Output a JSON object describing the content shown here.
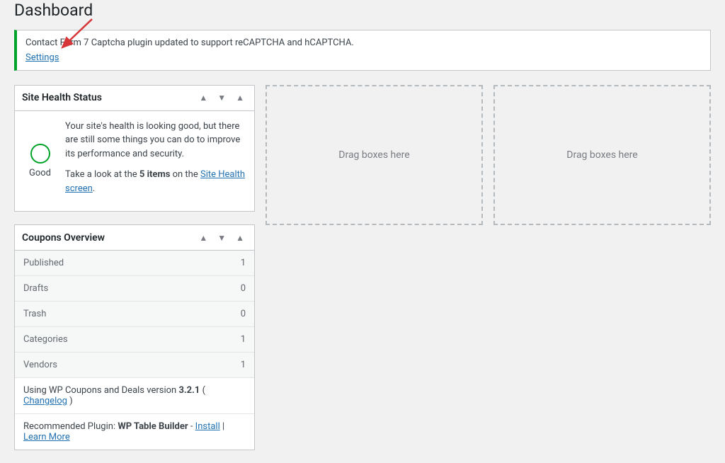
{
  "page_title": "Dashboard",
  "notice": {
    "text": "Contact Form 7 Captcha plugin updated to support reCAPTCHA and hCAPTCHA.",
    "link_label": "Settings"
  },
  "site_health": {
    "title": "Site Health Status",
    "status_label": "Good",
    "description_1": "Your site's health is looking good, but there are still some things you can do to improve its performance and security.",
    "description_2_prefix": "Take a look at the ",
    "items_count": "5 items",
    "description_2_mid": " on the ",
    "link_label": "Site Health screen",
    "description_2_suffix": "."
  },
  "coupons": {
    "title": "Coupons Overview",
    "rows": [
      {
        "label": "Published",
        "count": "1"
      },
      {
        "label": "Drafts",
        "count": "0"
      },
      {
        "label": "Trash",
        "count": "0"
      },
      {
        "label": "Categories",
        "count": "1"
      },
      {
        "label": "Vendors",
        "count": "1"
      }
    ],
    "version_prefix": "Using WP Coupons and Deals version ",
    "version": "3.2.1",
    "version_space": " ( ",
    "changelog_label": "Changelog",
    "version_close": " )",
    "rec_prefix": "Recommended Plugin: ",
    "rec_name": "WP Table Builder",
    "rec_sep": " - ",
    "install_label": "Install",
    "pipe": " | ",
    "learn_label": "Learn More"
  },
  "dropzone_text": "Drag boxes here"
}
